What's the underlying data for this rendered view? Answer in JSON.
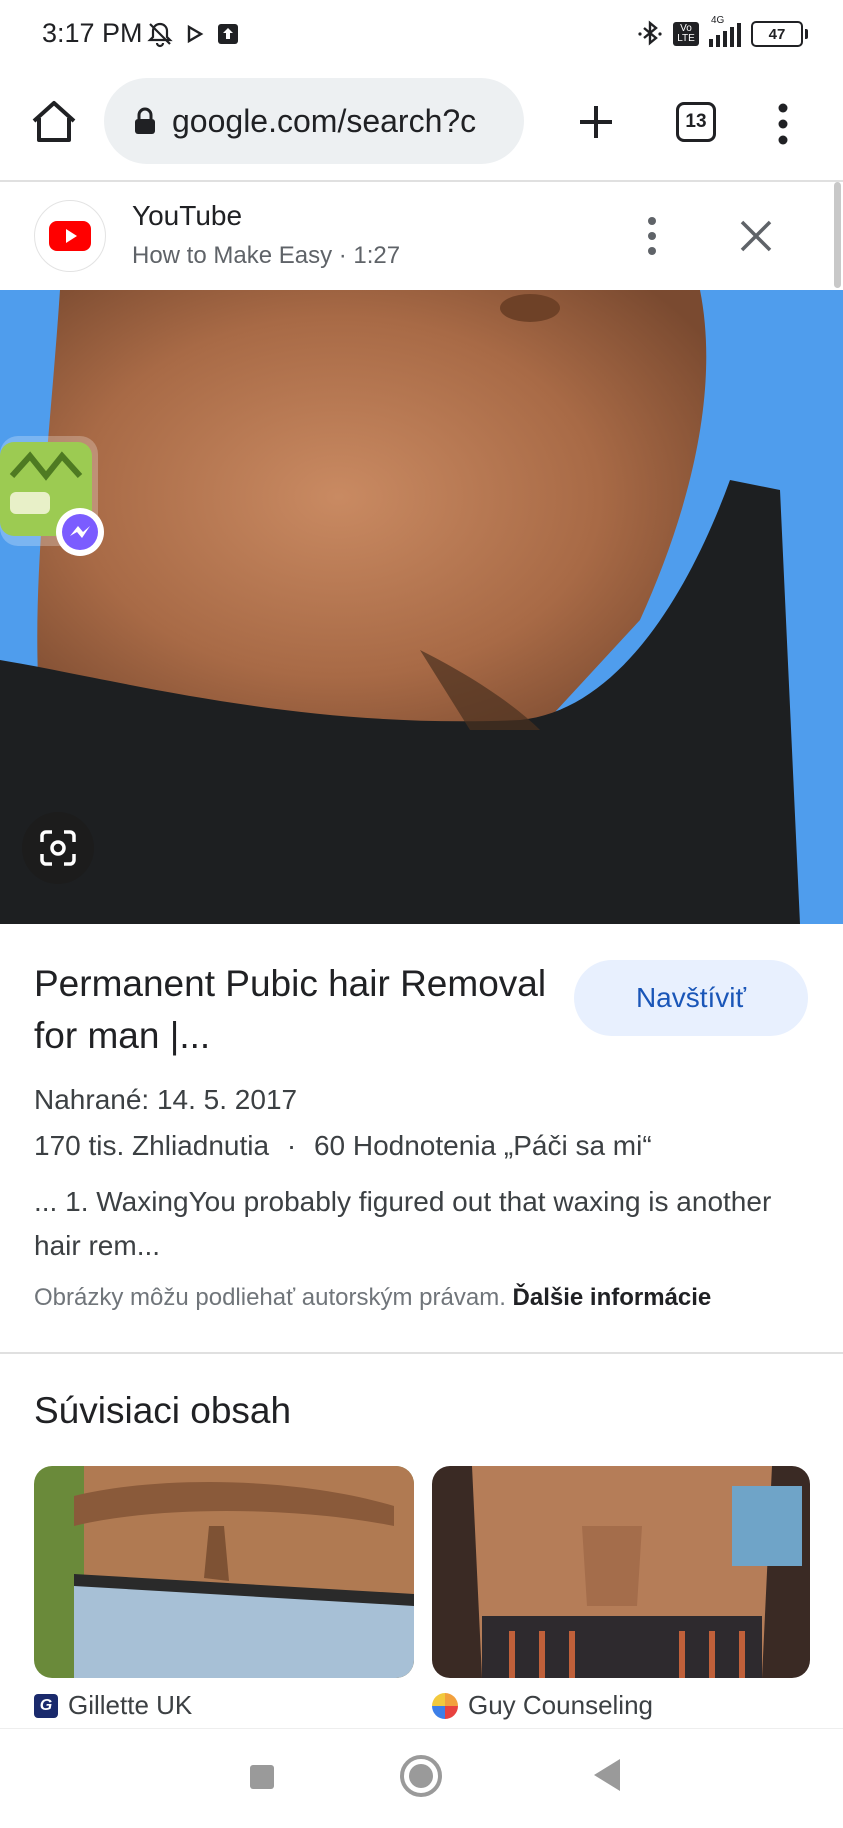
{
  "status_bar": {
    "time": "3:17 PM",
    "battery": "47",
    "network": "4G",
    "lte_badge": "Vo LTE"
  },
  "browser": {
    "url": "google.com/search?c",
    "tab_count": "13"
  },
  "source": {
    "name": "YouTube",
    "subtitle": "How to Make Easy · 1:27"
  },
  "result": {
    "title": "Permanent Pubic hair Removal for man |...",
    "visit_label": "Navštíviť",
    "uploaded": "Nahrané: 14. 5. 2017",
    "views": "170 tis. Zhliadnutia",
    "likes": "60 Hodnotenia „Páči sa mi“",
    "snippet": "... 1. WaxingYou probably figured out that waxing is another hair rem...",
    "copyright": "Obrázky môžu podliehať autorským právam.",
    "more_info": "Ďalšie informácie"
  },
  "related": {
    "heading": "Súvisiaci obsah",
    "items": [
      {
        "source": "Gillette UK",
        "badge": "G"
      },
      {
        "source": "Guy Counseling"
      }
    ]
  },
  "colors": {
    "image_bg": "#4f9ded",
    "accent": "#1a56b8",
    "visit_bg": "#e8f0fe",
    "youtube_red": "#ff0000"
  }
}
